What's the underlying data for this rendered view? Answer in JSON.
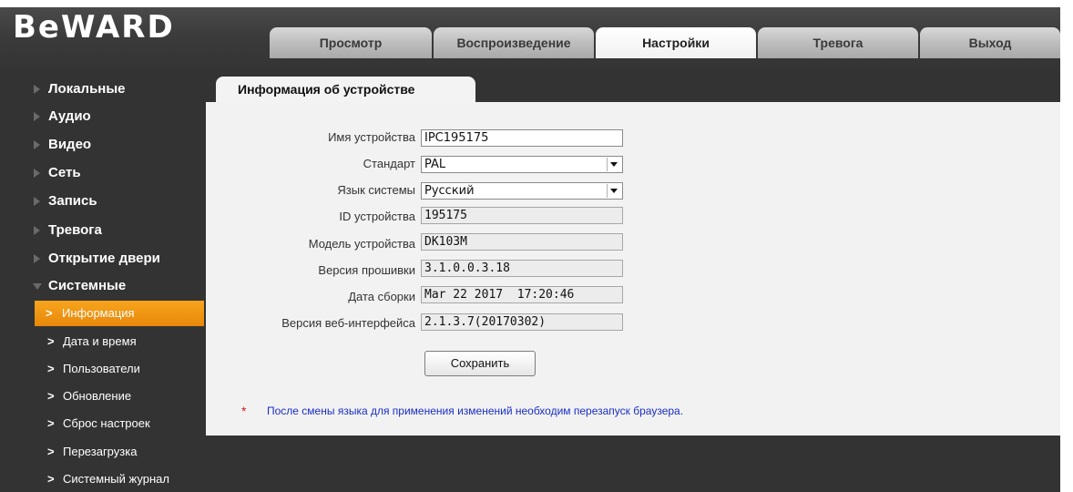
{
  "header": {
    "logo_text": "BeWARD",
    "tabs": [
      {
        "label": "Просмотр"
      },
      {
        "label": "Воспроизведение"
      },
      {
        "label": "Настройки"
      },
      {
        "label": "Тревога"
      },
      {
        "label": "Выход"
      }
    ],
    "active_tab": "Настройки"
  },
  "sidebar": {
    "items": [
      {
        "label": "Локальные"
      },
      {
        "label": "Аудио"
      },
      {
        "label": "Видео"
      },
      {
        "label": "Сеть"
      },
      {
        "label": "Запись"
      },
      {
        "label": "Тревога"
      },
      {
        "label": "Открытие двери"
      },
      {
        "label": "Системные"
      }
    ],
    "expanded": "Системные",
    "subitems": [
      {
        "label": "Информация"
      },
      {
        "label": "Дата и время"
      },
      {
        "label": "Пользователи"
      },
      {
        "label": "Обновление"
      },
      {
        "label": "Сброс настроек"
      },
      {
        "label": "Перезагрузка"
      },
      {
        "label": "Системный журнал"
      }
    ],
    "active_subitem": "Информация",
    "chevron": ">"
  },
  "main": {
    "tab_title": "Информация об устройстве",
    "fields": {
      "device_name": {
        "label": "Имя устройства",
        "value": "IPC195175"
      },
      "standard": {
        "label": "Стандарт",
        "value": "PAL"
      },
      "language": {
        "label": "Язык системы",
        "value": "Русский"
      },
      "device_id": {
        "label": "ID устройства",
        "value": "195175"
      },
      "device_model": {
        "label": "Модель устройства",
        "value": "DK103M"
      },
      "firmware": {
        "label": "Версия прошивки",
        "value": "3.1.0.0.3.18"
      },
      "build_date": {
        "label": "Дата сборки",
        "value": "Mar 22 2017  17:20:46"
      },
      "web_version": {
        "label": "Версия веб-интерфейса",
        "value": "2.1.3.7(20170302)"
      }
    },
    "save_label": "Сохранить",
    "note_star": "*",
    "note_text": "После смены языка для применения изменений необходим перезапуск браузера."
  },
  "colors": {
    "header_dark": "#3a3a3a",
    "sidebar_bg": "#333333",
    "active_orange": "#f39c16",
    "panel_bg": "#f2f2f2",
    "note_blue": "#1a2ec5",
    "note_red": "#d11c1c"
  },
  "icons": {
    "sidebar_collapsed": "triangle-right-icon",
    "sidebar_expanded": "triangle-down-icon",
    "select_arrow": "chevron-down-icon"
  }
}
